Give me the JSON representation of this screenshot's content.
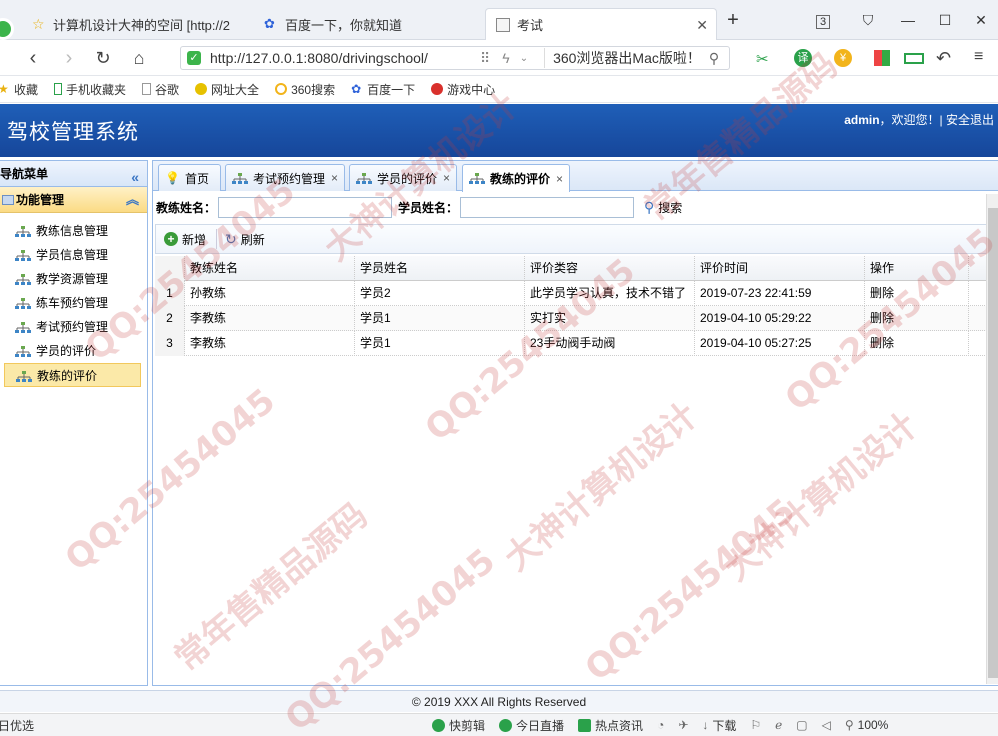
{
  "browser": {
    "tabs": [
      {
        "title": "计算机设计大神的空间 [http://2"
      },
      {
        "title": "百度一下，你就知道"
      },
      {
        "title": "考试"
      }
    ],
    "new_tab": "+",
    "tab_count": "3",
    "url": "http://127.0.0.1:8080/drivingschool/",
    "search_hint": "360浏览器出Mac版啦！",
    "translate_label": "译"
  },
  "bookmarks": [
    {
      "label": "收藏",
      "icon": "star-icon"
    },
    {
      "label": "手机收藏夹",
      "icon": "phone-icon"
    },
    {
      "label": "谷歌",
      "icon": "page-icon"
    },
    {
      "label": "网址大全",
      "icon": "globe-icon"
    },
    {
      "label": "360搜索",
      "icon": "search-360-icon"
    },
    {
      "label": "百度一下",
      "icon": "baidu-icon"
    },
    {
      "label": "游戏中心",
      "icon": "game-icon"
    }
  ],
  "app": {
    "title": "驾校管理系统",
    "user": "admin",
    "welcome": "，欢迎您！| 安全退出"
  },
  "west": {
    "header": "导航菜单",
    "group": "功能管理",
    "items": [
      {
        "label": "教练信息管理"
      },
      {
        "label": "学员信息管理"
      },
      {
        "label": "教学资源管理"
      },
      {
        "label": "练车预约管理"
      },
      {
        "label": "考试预约管理"
      },
      {
        "label": "学员的评价"
      },
      {
        "label": "教练的评价"
      }
    ],
    "selected_index": 6
  },
  "tabs": [
    {
      "label": "首页",
      "closable": false
    },
    {
      "label": "考试预约管理",
      "closable": true
    },
    {
      "label": "学员的评价",
      "closable": true
    },
    {
      "label": "教练的评价",
      "closable": true
    }
  ],
  "search": {
    "coach_label": "教练姓名：",
    "coach_value": "",
    "student_label": "学员姓名：",
    "student_value": "",
    "button": "搜索"
  },
  "toolbar": {
    "add": "新增",
    "refresh": "刷新"
  },
  "grid": {
    "columns": [
      "教练姓名",
      "学员姓名",
      "评价类容",
      "评价时间",
      "操作"
    ],
    "rows": [
      {
        "n": "1",
        "coach": "孙教练",
        "student": "学员2",
        "content": "此学员学习认真，技术不错了",
        "time": "2019-07-23 22:41:59",
        "op": "删除"
      },
      {
        "n": "2",
        "coach": "李教练",
        "student": "学员1",
        "content": "实打实",
        "time": "2019-04-10 05:29:22",
        "op": "删除"
      },
      {
        "n": "3",
        "coach": "李教练",
        "student": "学员1",
        "content": "23手动阀手动阀",
        "time": "2019-04-10 05:27:25",
        "op": "删除"
      }
    ]
  },
  "footer": "© 2019 XXX All Rights Reserved",
  "statusbar": {
    "left": "日优选",
    "items": [
      "快剪辑",
      "今日直播",
      "热点资讯",
      "下载"
    ],
    "zoom": "100%"
  },
  "watermark": [
    "QQ:25454045",
    "大神计算机设计",
    "常年售精品源码"
  ]
}
